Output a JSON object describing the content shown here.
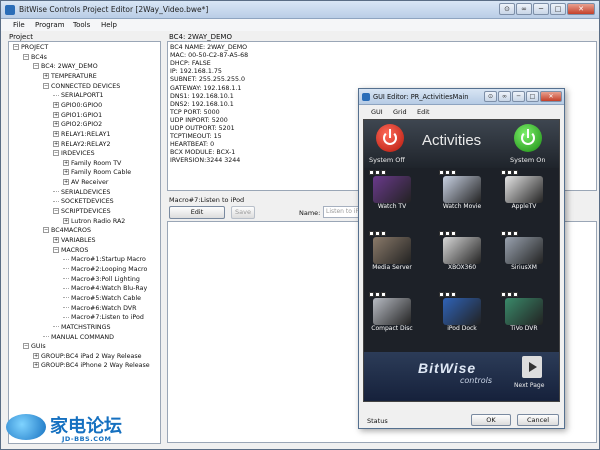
{
  "window": {
    "title": "BitWise Controls Project Editor [2Way_Video.bwe*]",
    "controls": [
      "⊙",
      "∞",
      "─",
      "□",
      "✕"
    ]
  },
  "menu": [
    "File",
    "Program",
    "Tools",
    "Help"
  ],
  "project_panel": {
    "label": "Project",
    "tree": [
      {
        "label": "PROJECT",
        "depth": 0,
        "expander": "−"
      },
      {
        "label": "BC4s",
        "depth": 1,
        "expander": "−"
      },
      {
        "label": "BC4: 2WAY_DEMO",
        "depth": 2,
        "expander": "−"
      },
      {
        "label": "TEMPERATURE",
        "depth": 3,
        "expander": "+"
      },
      {
        "label": "CONNECTED DEVICES",
        "depth": 3,
        "expander": "−"
      },
      {
        "label": "SERIALPORT1",
        "depth": 4,
        "expander": ""
      },
      {
        "label": "GPIO0:GPIO0",
        "depth": 4,
        "expander": "+"
      },
      {
        "label": "GPIO1:GPIO1",
        "depth": 4,
        "expander": "+"
      },
      {
        "label": "GPIO2:GPIO2",
        "depth": 4,
        "expander": "+"
      },
      {
        "label": "RELAY1:RELAY1",
        "depth": 4,
        "expander": "+"
      },
      {
        "label": "RELAY2:RELAY2",
        "depth": 4,
        "expander": "+"
      },
      {
        "label": "IRDEVICES",
        "depth": 4,
        "expander": "−"
      },
      {
        "label": "Family Room TV",
        "depth": 5,
        "expander": "+"
      },
      {
        "label": "Family Room Cable",
        "depth": 5,
        "expander": "+"
      },
      {
        "label": "AV Receiver",
        "depth": 5,
        "expander": "+"
      },
      {
        "label": "SERIALDEVICES",
        "depth": 4,
        "expander": ""
      },
      {
        "label": "SOCKETDEVICES",
        "depth": 4,
        "expander": ""
      },
      {
        "label": "SCRIPTDEVICES",
        "depth": 4,
        "expander": "−"
      },
      {
        "label": "Lutron Radio RA2",
        "depth": 5,
        "expander": "+"
      },
      {
        "label": "BC4MACROS",
        "depth": 3,
        "expander": "−"
      },
      {
        "label": "VARIABLES",
        "depth": 4,
        "expander": "+"
      },
      {
        "label": "MACROS",
        "depth": 4,
        "expander": "−"
      },
      {
        "label": "Macro#1:Startup Macro",
        "depth": 5,
        "expander": ""
      },
      {
        "label": "Macro#2:Looping Macro",
        "depth": 5,
        "expander": ""
      },
      {
        "label": "Macro#3:Poll Lighting",
        "depth": 5,
        "expander": ""
      },
      {
        "label": "Macro#4:Watch Blu-Ray",
        "depth": 5,
        "expander": ""
      },
      {
        "label": "Macro#5:Watch Cable",
        "depth": 5,
        "expander": ""
      },
      {
        "label": "Macro#6:Watch DVR",
        "depth": 5,
        "expander": ""
      },
      {
        "label": "Macro#7:Listen to iPod",
        "depth": 5,
        "expander": ""
      },
      {
        "label": "MATCHSTRINGS",
        "depth": 4,
        "expander": ""
      },
      {
        "label": "MANUAL COMMAND",
        "depth": 3,
        "expander": ""
      },
      {
        "label": "GUIs",
        "depth": 1,
        "expander": "−"
      },
      {
        "label": "GROUP:BC4 iPad 2 Way Release",
        "depth": 2,
        "expander": "+"
      },
      {
        "label": "GROUP:BC4 iPhone 2 Way Release",
        "depth": 2,
        "expander": "+"
      }
    ]
  },
  "info_panel": {
    "header": "BC4: 2WAY_DEMO",
    "lines": [
      "BC4 NAME: 2WAY_DEMO",
      "MAC: 00-50-C2-87-A5-68",
      "DHCP: FALSE",
      "IP: 192.168.1.75",
      "SUBNET: 255.255.255.0",
      "GATEWAY: 192.168.1.1",
      "DNS1: 192.168.10.1",
      "DNS2: 192.168.10.1",
      "TCP PORT: 5000",
      "UDP INPORT: 5200",
      "UDP OUTPORT: 5201",
      "TCPTIMEOUT: 15",
      "HEARTBEAT: 0",
      "BCX MODULE: BCX-1",
      "IRVERSION:3244 3244"
    ]
  },
  "macro_panel": {
    "header": "Macro#7:Listen to iPod",
    "edit_label": "Edit",
    "save_label": "Save",
    "name_label": "Name:",
    "name_value": "Listen to iPod"
  },
  "gui_editor": {
    "title": "GUI Editor: PR_ActivitiesMain",
    "controls": [
      "⊙",
      "∞",
      "─",
      "□",
      "✕"
    ],
    "menu": [
      "GUI",
      "Grid",
      "Edit"
    ],
    "screen": {
      "title": "Activities",
      "system_off": "System Off",
      "system_on": "System On",
      "tiles": [
        {
          "label": "Watch TV",
          "color": "#6a3a8c"
        },
        {
          "label": "Watch Movie",
          "color": "#c9d2e3"
        },
        {
          "label": "AppleTV",
          "color": "#e5e5e5"
        },
        {
          "label": "Media Server",
          "color": "#8a7a6a"
        },
        {
          "label": "XBOX360",
          "color": "#d8d8d8"
        },
        {
          "label": "SiriusXM",
          "color": "#9aa3b0"
        },
        {
          "label": "Compact Disc",
          "color": "#b8bcc4"
        },
        {
          "label": "iPod Dock",
          "color": "#2f63b8"
        },
        {
          "label": "TiVo DVR",
          "color": "#3a8a6a"
        }
      ],
      "brand": "BitWise",
      "brand_sub": "controls",
      "next_page": "Next Page"
    },
    "status": "Status",
    "ok_label": "OK",
    "cancel_label": "Cancel"
  },
  "watermark": {
    "text": "家电论坛",
    "sub": "JD-BBS.COM"
  }
}
